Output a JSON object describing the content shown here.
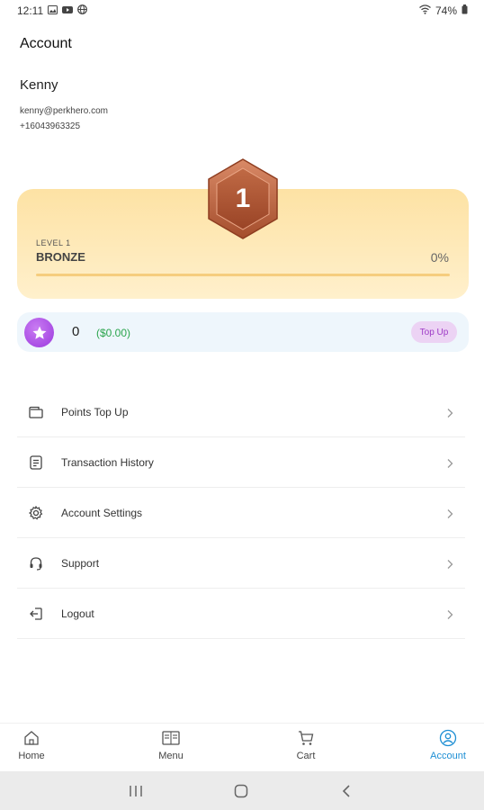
{
  "status_bar": {
    "time": "12:11",
    "battery": "74%",
    "icons": [
      "image-icon",
      "youtube-icon",
      "globe-icon",
      "wifi-icon",
      "battery-icon"
    ]
  },
  "header": {
    "title": "Account"
  },
  "user": {
    "name": "Kenny",
    "email": "kenny@perkhero.com",
    "phone": "+16043963325"
  },
  "level": {
    "badge_number": "1",
    "label": "LEVEL 1",
    "name": "BRONZE",
    "percent_text": "0%",
    "progress": 0
  },
  "points": {
    "value": "0",
    "money": "($0.00)",
    "topup_label": "Top Up",
    "icon": "star-icon"
  },
  "menu": {
    "items": [
      {
        "label": "Points Top Up",
        "icon": "wallet-icon"
      },
      {
        "label": "Transaction History",
        "icon": "receipt-icon"
      },
      {
        "label": "Account Settings",
        "icon": "gear-icon"
      },
      {
        "label": "Support",
        "icon": "headset-icon"
      },
      {
        "label": "Logout",
        "icon": "logout-icon"
      }
    ]
  },
  "bottom_nav": {
    "items": [
      {
        "label": "Home",
        "icon": "home-icon",
        "active": false
      },
      {
        "label": "Menu",
        "icon": "menu-icon",
        "active": false
      },
      {
        "label": "Cart",
        "icon": "cart-icon",
        "active": false
      },
      {
        "label": "Account",
        "icon": "account-icon",
        "active": true
      }
    ]
  },
  "colors": {
    "accent": "#1e8fd4",
    "bronze": "#b8603c",
    "points_green": "#2aa44c",
    "topup_purple": "#9d3ac6",
    "level_card": "#fde2a4",
    "points_card": "#eef6fc"
  }
}
